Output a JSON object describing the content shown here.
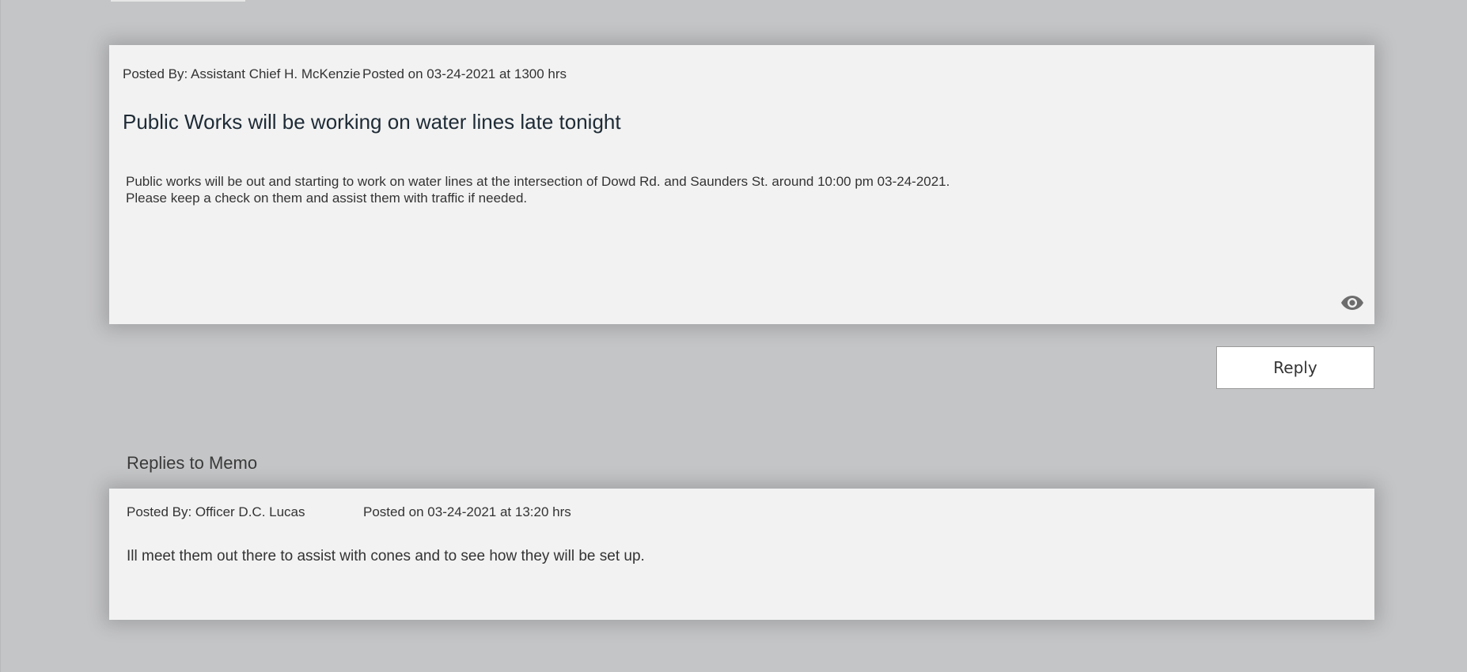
{
  "memo": {
    "posted_by": "Posted By: Assistant Chief H. McKenzie",
    "posted_on": "Posted on 03-24-2021 at 1300 hrs",
    "title": "Public Works will be working on water lines late tonight",
    "body_lines": [
      "Public works will be out and starting to work on water lines at the intersection of Dowd Rd. and Saunders St. around 10:00 pm 03-24-2021.",
      "Please keep a check on them and assist them with traffic if needed."
    ],
    "view_icon": "eye-icon"
  },
  "actions": {
    "reply_label": "Reply"
  },
  "replies": {
    "heading": "Replies to Memo",
    "items": [
      {
        "posted_by": "Posted By: Officer D.C. Lucas",
        "posted_on": "Posted on 03-24-2021 at 13:20 hrs",
        "body": "Ill meet them out there to assist with cones and to see how they will be set up."
      }
    ]
  },
  "colors": {
    "background": "#c4c5c7",
    "card": "#f2f2f2",
    "title_text": "#1e2b36",
    "icon": "#6d6d6d"
  }
}
